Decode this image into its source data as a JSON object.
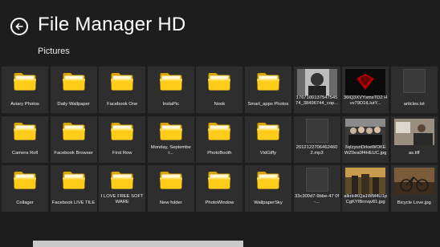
{
  "app": {
    "title": "File Manager HD",
    "section": "Pictures"
  },
  "tiles": [
    {
      "label": "Aviary Photos",
      "type": "folder"
    },
    {
      "label": "Daily Wallpaper",
      "type": "folder"
    },
    {
      "label": "Facebook One",
      "type": "folder"
    },
    {
      "label": "InstaPic",
      "type": "folder"
    },
    {
      "label": "Nook",
      "type": "folder"
    },
    {
      "label": "Smart_apps Photos",
      "type": "folder"
    },
    {
      "label": "1767100137547545 74_38496744_cop...",
      "type": "photo",
      "icon": "portrait-photo-thumbnail"
    },
    {
      "label": "36lQ3XVYsmsTD2 Hvv79D1tLIutY...",
      "type": "photo",
      "icon": "logo-photo-thumbnail"
    },
    {
      "label": "articles.txt",
      "type": "file",
      "icon": "text-file-icon"
    },
    {
      "label": "Camera Roll",
      "type": "folder"
    },
    {
      "label": "Facebook Browser",
      "type": "folder"
    },
    {
      "label": "First Row",
      "type": "folder"
    },
    {
      "label": "Monday, September...",
      "type": "folder"
    },
    {
      "label": "PhotoBooth",
      "type": "folder"
    },
    {
      "label": "VidGiffy",
      "type": "folder"
    },
    {
      "label": "2012122706462460 2.mp3",
      "type": "file",
      "icon": "audio-file-icon"
    },
    {
      "label": "3qIzyunDrkwWOKE WZ0ea0f4HEUC.jpg",
      "type": "photo",
      "icon": "group-photo-thumbnail"
    },
    {
      "label": "as.tiff",
      "type": "photo",
      "icon": "office-photo-thumbnail"
    },
    {
      "label": "Collager",
      "type": "folder"
    },
    {
      "label": "Facebook LIVE TILE",
      "type": "folder"
    },
    {
      "label": "I LOVE FREE SOFTWARE",
      "type": "folder"
    },
    {
      "label": "New folder",
      "type": "folder"
    },
    {
      "label": "PhotoWindow",
      "type": "folder"
    },
    {
      "label": "WallpaperSky",
      "type": "folder"
    },
    {
      "label": "33c300d7-9bbe-47 0f-...",
      "type": "file",
      "icon": "image-file-icon"
    },
    {
      "label": "alknHKQa1WM4U1p CgKYIBnnqv81.jpg",
      "type": "photo",
      "icon": "poster-photo-thumbnail"
    },
    {
      "label": "Bicycle Love.jpg",
      "type": "photo",
      "icon": "bicycle-photo-thumbnail"
    }
  ]
}
